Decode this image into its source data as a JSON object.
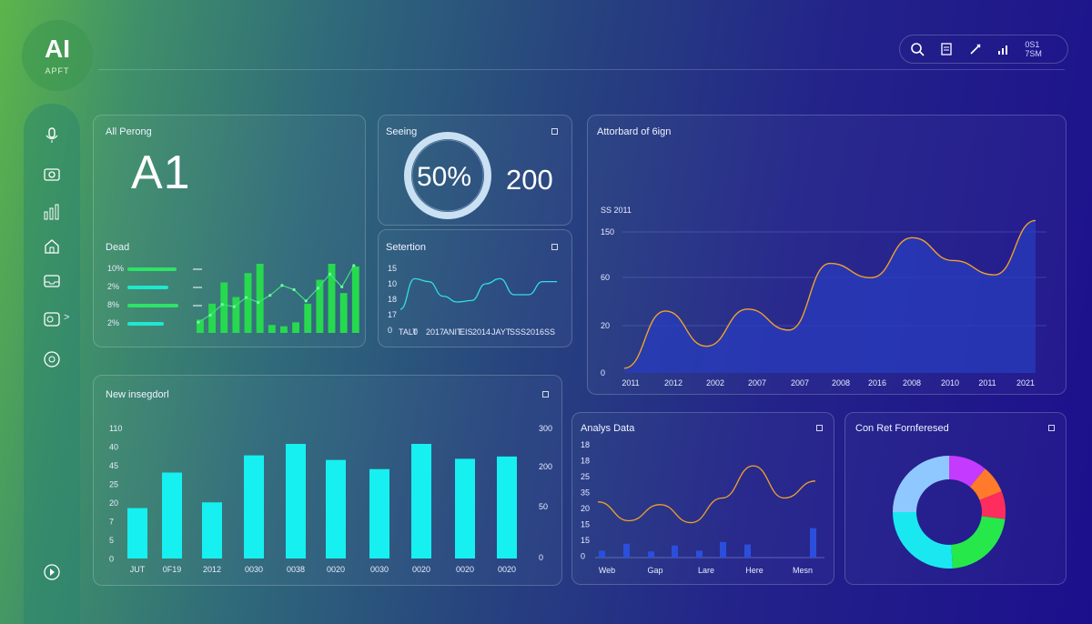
{
  "logo": {
    "title": "AI",
    "subtitle": "APFT"
  },
  "toolbar": {
    "icons": [
      "search-icon",
      "document-icon",
      "edit-icon",
      "signal-icon"
    ],
    "clock": "0S1 7SM"
  },
  "sidebar": {
    "icons": [
      "microphone-icon",
      "camera-icon",
      "bar-chart-icon",
      "home-icon",
      "inbox-icon",
      "gallery-icon",
      "circle-icon",
      "play-icon"
    ],
    "expand_glyph": ">"
  },
  "panel_ai": {
    "title": "All Perong",
    "value": "A1",
    "subtitle": "Dead",
    "items": [
      {
        "label": "10%",
        "fill": 0.82
      },
      {
        "label": "2%",
        "fill": 0.68
      },
      {
        "label": "8%",
        "fill": 0.85
      },
      {
        "label": "2%",
        "fill": 0.6
      }
    ],
    "dash_marks": 3,
    "chart_data": {
      "type": "bar",
      "values": [
        10,
        22,
        38,
        27,
        45,
        52,
        6,
        5,
        8,
        22,
        40,
        52,
        30,
        50
      ],
      "line": [
        10,
        20,
        35,
        32,
        45,
        38,
        48,
        62,
        56,
        40,
        58,
        78,
        60,
        90
      ]
    }
  },
  "panel_seeing": {
    "title": "Seeing",
    "percent_label": "50%",
    "percent_value": 0.5,
    "count": "200"
  },
  "panel_selection": {
    "title": "Setertion",
    "chart_data": {
      "type": "line",
      "yticks": [
        "15",
        "10",
        "18",
        "17",
        "0"
      ],
      "xticks": [
        "TALT",
        "0",
        "2017",
        "ANIT",
        "EIS",
        "2014",
        "JAYT",
        "SSS",
        "2016",
        "SS"
      ],
      "values": [
        20,
        62,
        58,
        38,
        30,
        32,
        55,
        62,
        40,
        40,
        58,
        58
      ]
    }
  },
  "panel_main": {
    "title": "Attorbard of 6ign",
    "series_label": "SS 2011",
    "chart_data": {
      "type": "area",
      "yticks": [
        "150",
        "60",
        "20",
        "0"
      ],
      "xticks": [
        "2011",
        "2012",
        "2002",
        "2007",
        "2007",
        "2008",
        "2016",
        "2008",
        "2010",
        "2011",
        "2021"
      ],
      "values": [
        5,
        65,
        28,
        67,
        45,
        115,
        100,
        142,
        118,
        103,
        160
      ]
    }
  },
  "panel_new": {
    "title": "New insegdorl",
    "chart_data": {
      "type": "bar",
      "yticks_left": [
        "110",
        "40",
        "45",
        "25",
        "20",
        "7",
        "5",
        "0"
      ],
      "yticks_right": [
        "300",
        "200",
        "50",
        "0"
      ],
      "xticks": [
        "JUT",
        "0F19",
        "2012",
        "0030",
        "0038",
        "0020",
        "0030",
        "0020",
        "0020",
        "0020"
      ],
      "values": [
        0.44,
        0.75,
        0.49,
        0.9,
        1.0,
        0.86,
        0.78,
        1.0,
        0.87,
        0.89
      ]
    }
  },
  "panel_analys": {
    "title": "Analys Data",
    "chart_data": {
      "type": "line",
      "yticks": [
        "18",
        "18",
        "25",
        "35",
        "20",
        "15",
        "15",
        "0"
      ],
      "xticks": [
        "Web",
        "Gap",
        "Lare",
        "Here",
        "Mesn"
      ],
      "values": [
        58,
        38,
        55,
        36,
        62,
        96,
        62,
        80
      ],
      "bars": [
        0.2,
        0.4,
        0.18,
        0.35,
        0.2,
        0.45,
        0.38,
        0.85
      ]
    }
  },
  "panel_donut": {
    "title": "Con Ret Fornferesed",
    "chart_data": {
      "type": "pie",
      "values": [
        11,
        8,
        8,
        22,
        26,
        25
      ],
      "colors": [
        "#c43bff",
        "#ff7a2a",
        "#ff2d5e",
        "#26e84a",
        "#19e8f0",
        "#8fc8ff"
      ]
    }
  }
}
